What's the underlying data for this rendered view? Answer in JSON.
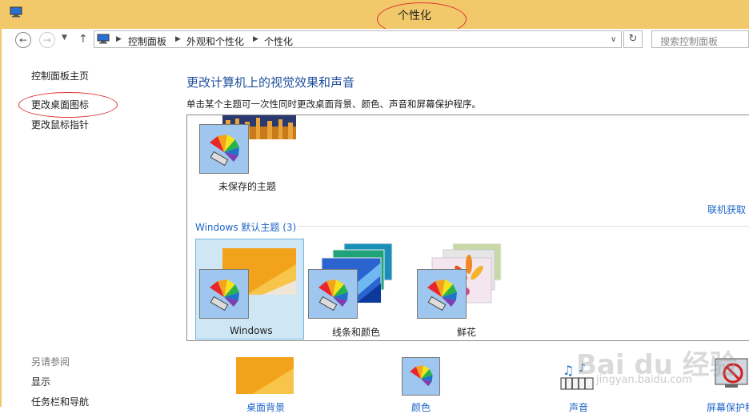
{
  "window": {
    "title": "个性化"
  },
  "nav": {
    "breadcrumbs": [
      "控制面板",
      "外观和个性化",
      "个性化"
    ],
    "search_placeholder": "搜索控制面板"
  },
  "sidebar": {
    "links": [
      "控制面板主页",
      "更改桌面图标",
      "更改鼠标指针"
    ],
    "see_also_title": "另请参阅",
    "see_also_links": [
      "显示",
      "任务栏和导航"
    ]
  },
  "main": {
    "heading": "更改计算机上的视觉效果和声音",
    "description": "单击某个主题可一次性同时更改桌面背景、颜色、声音和屏幕保护程序。",
    "unsaved_theme_label": "未保存的主题",
    "online_link": "联机获取",
    "group_title": "Windows 默认主题 (3)",
    "themes": [
      "Windows",
      "线条和颜色",
      "鲜花"
    ],
    "bottom_items": [
      "桌面背景",
      "颜色",
      "声音",
      "屏幕保护程"
    ]
  },
  "watermark": {
    "brand": "Bai du 经验",
    "url": "jingyan.baidu.com"
  },
  "colors": {
    "titlebar": "#f2c96a",
    "accent_link": "#1e64c8",
    "heading": "#1e4e9c",
    "annotation": "#dd3333",
    "selection": "#cfe6f5"
  }
}
